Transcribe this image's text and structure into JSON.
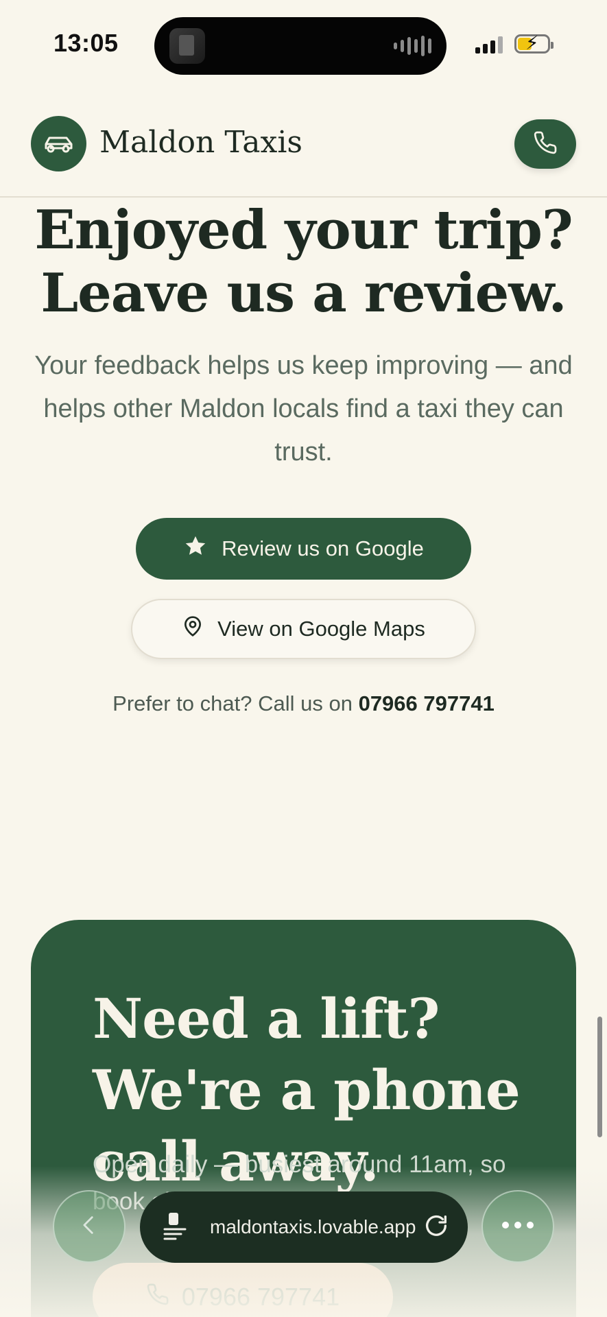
{
  "status_bar": {
    "time": "13:05"
  },
  "header": {
    "brand": "Maldon Taxis"
  },
  "review": {
    "headline_line1": "Enjoyed your trip?",
    "headline_line2": "Leave us a review.",
    "subtext": "Your feedback helps us keep improving — and helps other Maldon locals find a taxi they can trust.",
    "primary_button": "Review us on Google",
    "secondary_button": "View on Google Maps",
    "chat_prefix": "Prefer to chat? Call us on",
    "phone": "07966 797741"
  },
  "cta": {
    "title": "Need a lift? We're a phone call away.",
    "subtext": "Open daily — busiest around 11am, so book ahead when you can.",
    "phone_button": "07966 797741"
  },
  "browser": {
    "url": "maldontaxis.lovable.app"
  },
  "colors": {
    "brand_green": "#2d5a3d",
    "background": "#f9f6ec",
    "accent_peach": "#f2c9a3"
  }
}
